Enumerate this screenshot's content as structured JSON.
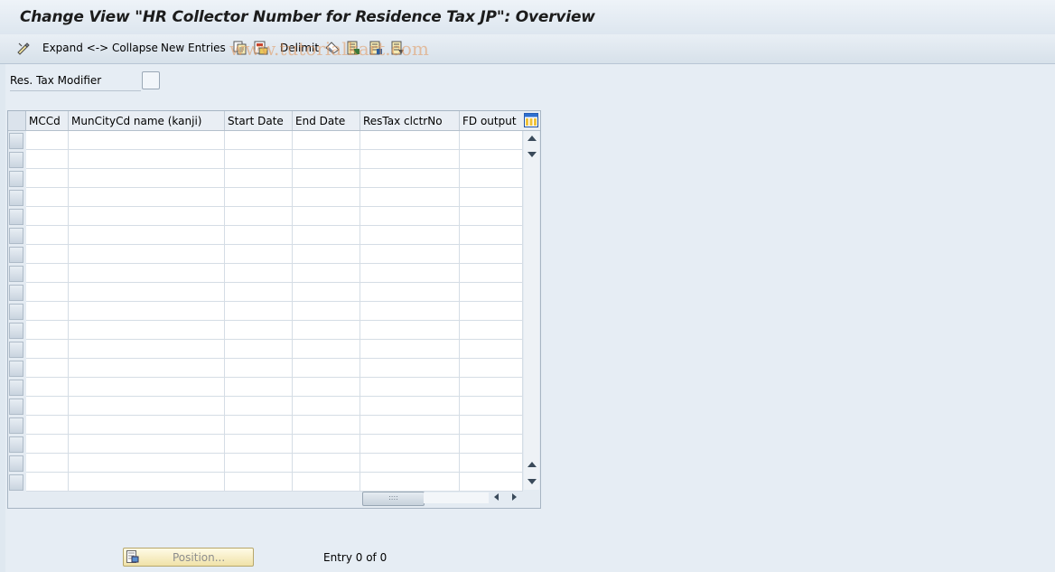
{
  "window": {
    "title": "Change View \"HR Collector Number for Residence Tax JP\": Overview"
  },
  "toolbar": {
    "expand_collapse": "Expand <-> Collapse",
    "new_entries": "New Entries",
    "delimit": "Delimit",
    "icons": [
      "display-change-icon",
      "copy-icon",
      "save-as-icon",
      "undo-icon",
      "delimit-icon",
      "select-all-icon",
      "select-block-icon",
      "deselect-all-icon"
    ]
  },
  "watermark": "www.tutorialkart.com",
  "filter": {
    "res_tax_modifier_label": "Res. Tax Modifier",
    "res_tax_modifier_checked": false
  },
  "table": {
    "columns": [
      "MCCd",
      "MunCityCd name (kanji)",
      "Start Date",
      "End Date",
      "ResTax clctrNo",
      "FD output"
    ],
    "rows": []
  },
  "footer": {
    "position_button": "Position...",
    "entry_text": "Entry 0 of 0"
  },
  "colors": {
    "title_bg": "#e4ecf3",
    "toolbar_bg": "#dbe4ed",
    "button_gold": "#f0e2a8"
  }
}
